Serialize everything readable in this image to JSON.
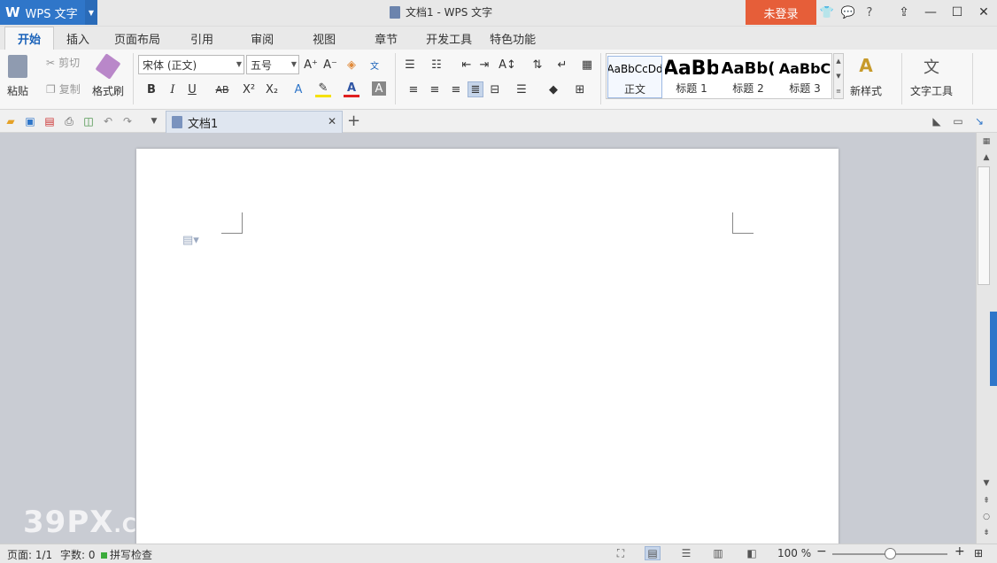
{
  "app": {
    "name": "WPS 文字",
    "logo": "W",
    "window_title": "文档1 - WPS 文字",
    "login_label": "未登录",
    "brand_color": "#2f76c9",
    "login_color": "#e65e39"
  },
  "menu_tabs": [
    "开始",
    "插入",
    "页面布局",
    "引用",
    "审阅",
    "视图",
    "章节",
    "开发工具",
    "特色功能"
  ],
  "ribbon": {
    "paste_label": "粘贴",
    "cut_label": "剪切",
    "copy_label": "复制",
    "format_painter_label": "格式刷",
    "font_name": "宋体 (正文)",
    "font_size": "五号",
    "styles": [
      {
        "sample": "AaBbCcDd",
        "name": "正文"
      },
      {
        "sample": "AaBb",
        "name": "标题 1"
      },
      {
        "sample": "AaBb(",
        "name": "标题 2"
      },
      {
        "sample": "AaBbC",
        "name": "标题 3"
      }
    ],
    "new_style_label": "新样式",
    "text_tools_label": "文字工具"
  },
  "doc_tab": {
    "title": "文档1"
  },
  "watermark": {
    "main": "39PX",
    "suffix": ".COM"
  },
  "status": {
    "page": "页面: 1/1",
    "words": "字数: 0",
    "spell": "拼写检查",
    "zoom": "100 %",
    "zoom_level_percent": 100
  }
}
